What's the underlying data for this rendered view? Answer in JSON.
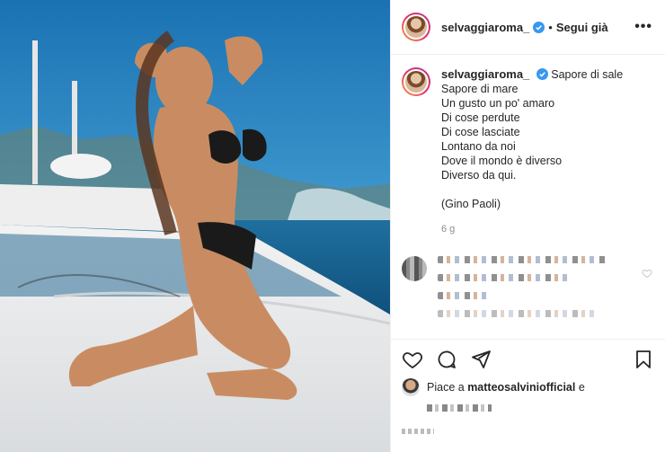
{
  "post": {
    "username": "selvaggiaroma_",
    "follow_label": "Segui già",
    "more_label": "•••",
    "caption_first": "Sapore di sale",
    "caption_lines": [
      "Sapore di mare",
      "Un gusto un po' amaro",
      "Di cose perdute",
      "Di cose lasciate",
      "Lontano da noi",
      "Dove il mondo è diverso",
      "Diverso da qui."
    ],
    "caption_credit": "(Gino Paoli)",
    "timestamp": "6 g"
  },
  "likes": {
    "prefix": "Piace a",
    "liked_by": "matteosalviniofficial",
    "conjunction": "e"
  },
  "icons": [
    "verified-badge-icon",
    "more-options-icon",
    "heart-icon",
    "comment-icon",
    "share-icon",
    "bookmark-icon"
  ],
  "colors": {
    "accent": "#0095f6",
    "verified": "#3897f0",
    "muted": "#8e8e8e",
    "text": "#262626"
  }
}
